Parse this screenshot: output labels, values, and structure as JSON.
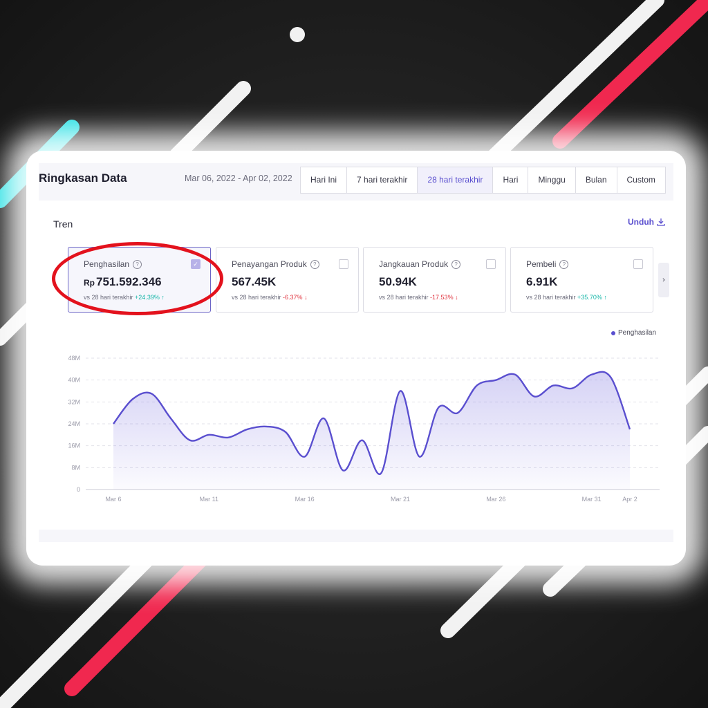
{
  "header": {
    "title": "Ringkasan Data",
    "date_range": "Mar 06, 2022 - Apr 02, 2022",
    "tabs": [
      {
        "label": "Hari Ini",
        "active": false
      },
      {
        "label": "7 hari terakhir",
        "active": false
      },
      {
        "label": "28 hari terakhir",
        "active": true
      },
      {
        "label": "Hari",
        "active": false
      },
      {
        "label": "Minggu",
        "active": false
      },
      {
        "label": "Bulan",
        "active": false
      },
      {
        "label": "Custom",
        "active": false
      }
    ]
  },
  "section": {
    "title": "Tren",
    "download_label": "Unduh"
  },
  "cards": [
    {
      "label": "Penghasilan",
      "prefix": "Rp",
      "value": "751.592.346",
      "compare_text": "vs 28 hari terakhir",
      "change": "+24.39%",
      "direction": "up",
      "checked": true
    },
    {
      "label": "Penayangan Produk",
      "prefix": "",
      "value": "567.45K",
      "compare_text": "vs 28 hari terakhir",
      "change": "-6.37%",
      "direction": "down",
      "checked": false
    },
    {
      "label": "Jangkauan Produk",
      "prefix": "",
      "value": "50.94K",
      "compare_text": "vs 28 hari terakhir",
      "change": "-17.53%",
      "direction": "down",
      "checked": false
    },
    {
      "label": "Pembeli",
      "prefix": "",
      "value": "6.91K",
      "compare_text": "vs 28 hari terakhir",
      "change": "+35.70%",
      "direction": "up",
      "checked": false
    }
  ],
  "colors": {
    "accent": "#5a4fcf",
    "up": "#12b5a6",
    "down": "#e0333e",
    "highlight_ring": "#e3121d"
  },
  "chart_data": {
    "type": "area",
    "legend": "Penghasilan",
    "legend_position": "top-right",
    "y_ticks": [
      "0",
      "8M",
      "16M",
      "24M",
      "32M",
      "40M",
      "48M"
    ],
    "ylim": [
      0,
      48
    ],
    "y_unit": "M",
    "x_ticks": [
      "Mar 6",
      "Mar 11",
      "Mar 16",
      "Mar 21",
      "Mar 26",
      "Mar 31",
      "Apr 2"
    ],
    "x": [
      "Mar 6",
      "Mar 7",
      "Mar 8",
      "Mar 9",
      "Mar 10",
      "Mar 11",
      "Mar 12",
      "Mar 13",
      "Mar 14",
      "Mar 15",
      "Mar 16",
      "Mar 17",
      "Mar 18",
      "Mar 19",
      "Mar 20",
      "Mar 21",
      "Mar 22",
      "Mar 23",
      "Mar 24",
      "Mar 25",
      "Mar 26",
      "Mar 27",
      "Mar 28",
      "Mar 29",
      "Mar 30",
      "Mar 31",
      "Apr 1",
      "Apr 2"
    ],
    "series": [
      {
        "values": [
          24,
          33,
          35,
          26,
          18,
          20,
          19,
          22,
          23,
          21,
          12,
          26,
          7,
          18,
          6,
          36,
          12,
          30,
          28,
          38,
          40,
          42,
          34,
          38,
          37,
          42,
          41,
          22
        ]
      }
    ],
    "grid": true
  }
}
